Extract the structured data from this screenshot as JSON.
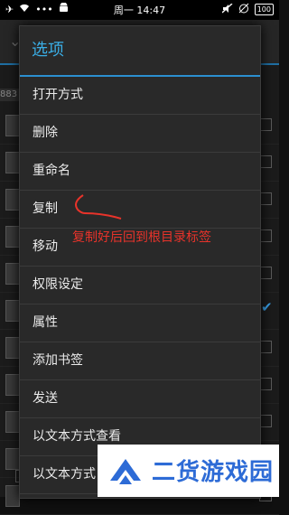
{
  "status_bar": {
    "center_text": "周一 14:47",
    "battery": "100",
    "icons": [
      "airplane-icon",
      "wifi-icon",
      "dots-icon",
      "android-icon",
      "mute-icon",
      "alarm-off-icon",
      "battery-icon"
    ]
  },
  "background": {
    "path_fragment": "883",
    "rows": 11,
    "checked_row": 5
  },
  "dialog": {
    "title": "选项",
    "items": [
      {
        "label": "打开方式"
      },
      {
        "label": "删除"
      },
      {
        "label": "重命名"
      },
      {
        "label": "复制"
      },
      {
        "label": "移动"
      },
      {
        "label": "权限设定"
      },
      {
        "label": "属性"
      },
      {
        "label": "添加书签"
      },
      {
        "label": "发送"
      },
      {
        "label": "以文本方式查看"
      },
      {
        "label": "以文本方式"
      }
    ]
  },
  "annotation": {
    "text": "复制好后回到根目录标签",
    "color": "#e8332a"
  },
  "watermark": {
    "text": "二货游戏园",
    "color": "#2d6bd6"
  },
  "colors": {
    "accent": "#2b8fd0",
    "title": "#3aaee6"
  }
}
